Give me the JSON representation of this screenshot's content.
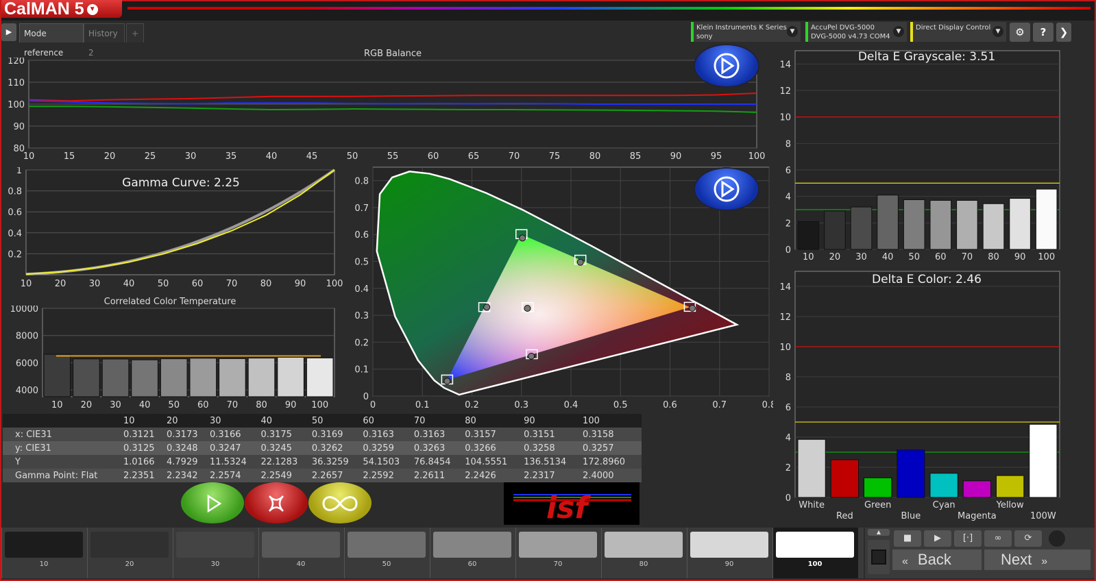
{
  "app": {
    "logo": "CalMAN 5"
  },
  "tabs": [
    {
      "label": "Mode reference"
    },
    {
      "label": "History 2"
    },
    {
      "label": "+"
    }
  ],
  "devices": [
    {
      "line1": "Klein Instruments K Series",
      "line2": "sony",
      "color": "#2cd42c"
    },
    {
      "line1": "AccuPel DVG-5000",
      "line2": "DVG-5000 v4.73 COM4",
      "color": "#2cd42c"
    },
    {
      "line1": "Direct Display Control",
      "line2": "",
      "color": "#e8e01a"
    }
  ],
  "toolbar": {
    "settings_icon": "gear-icon",
    "help_label": "?",
    "collapse_icon": "chevron-right-icon"
  },
  "rgb_balance": {
    "title": "RGB Balance",
    "chart_data": {
      "type": "line",
      "x": [
        10,
        15,
        20,
        25,
        30,
        35,
        40,
        45,
        50,
        55,
        60,
        65,
        70,
        75,
        80,
        85,
        90,
        95,
        100
      ],
      "series": [
        {
          "values": [
            102,
            101.5,
            102,
            102.3,
            102.5,
            103,
            103.5,
            103.5,
            103.5,
            103.7,
            103.8,
            104,
            104,
            104,
            104,
            104,
            104,
            104.2,
            105
          ],
          "color": "#e01010"
        },
        {
          "values": [
            101.5,
            101,
            100.5,
            100.3,
            100.2,
            100.5,
            100.5,
            100.5,
            100.3,
            100.2,
            100.3,
            100.2,
            100.3,
            100.2,
            100,
            100,
            100,
            100,
            100
          ],
          "color": "#2030ff"
        },
        {
          "values": [
            99,
            99,
            98.8,
            98.5,
            98.2,
            97.8,
            97.5,
            97.6,
            97.8,
            97.7,
            97.6,
            97.5,
            97.5,
            97.4,
            97.3,
            97.2,
            97,
            96.8,
            96.3
          ],
          "color": "#10a010"
        }
      ],
      "xlim": [
        10,
        100
      ],
      "ylim": [
        80,
        120
      ],
      "xticks": [
        "10",
        "15",
        "20",
        "25",
        "30",
        "35",
        "40",
        "45",
        "50",
        "55",
        "60",
        "65",
        "70",
        "75",
        "80",
        "85",
        "90",
        "95",
        "100"
      ],
      "yticks": [
        "120",
        "110",
        "100",
        "90",
        "80"
      ]
    }
  },
  "gamma": {
    "title": "Gamma Curve: 2.25",
    "chart_data": {
      "type": "line",
      "x": [
        10,
        20,
        30,
        40,
        50,
        60,
        70,
        80,
        90,
        100
      ],
      "target_gamma": 2.25,
      "measured": [
        0.006,
        0.027,
        0.065,
        0.121,
        0.198,
        0.298,
        0.42,
        0.568,
        0.762,
        1.0
      ],
      "xlim": [
        10,
        100
      ],
      "ylim": [
        0,
        1
      ],
      "xticks": [
        "10",
        "20",
        "30",
        "40",
        "50",
        "60",
        "70",
        "80",
        "90",
        "100"
      ],
      "yticks": [
        "1",
        "0.8",
        "0.6",
        "0.4",
        "0.2"
      ]
    }
  },
  "cct": {
    "title": "Correlated Color Temperature",
    "chart_data": {
      "type": "bar",
      "categories": [
        "10",
        "20",
        "30",
        "40",
        "50",
        "60",
        "70",
        "80",
        "90",
        "100"
      ],
      "values": [
        6620,
        6280,
        6270,
        6210,
        6290,
        6330,
        6300,
        6340,
        6400,
        6350
      ],
      "target": 6500,
      "ylim": [
        3500,
        10000
      ],
      "yticks": [
        "10000",
        "8000",
        "6000",
        "4000"
      ]
    }
  },
  "cie": {
    "chart_data": {
      "type": "scatter",
      "gamut_targets": [
        {
          "x": 0.64,
          "y": 0.33
        },
        {
          "x": 0.3,
          "y": 0.6
        },
        {
          "x": 0.15,
          "y": 0.06
        },
        {
          "x": 0.225,
          "y": 0.329
        },
        {
          "x": 0.321,
          "y": 0.154
        },
        {
          "x": 0.419,
          "y": 0.505
        },
        {
          "x": 0.3127,
          "y": 0.329
        }
      ],
      "measured": [
        {
          "x": 0.645,
          "y": 0.326
        },
        {
          "x": 0.302,
          "y": 0.587
        },
        {
          "x": 0.15,
          "y": 0.055
        },
        {
          "x": 0.23,
          "y": 0.33
        },
        {
          "x": 0.32,
          "y": 0.148
        },
        {
          "x": 0.419,
          "y": 0.497
        },
        {
          "x": 0.3121,
          "y": 0.3257
        }
      ],
      "xlim": [
        0,
        0.8
      ],
      "ylim": [
        0,
        0.85
      ],
      "xticks": [
        "0",
        "0.1",
        "0.2",
        "0.3",
        "0.4",
        "0.5",
        "0.6",
        "0.7",
        "0.8"
      ],
      "yticks": [
        "0.8",
        "0.7",
        "0.6",
        "0.5",
        "0.4",
        "0.3",
        "0.2",
        "0.1",
        "0"
      ]
    }
  },
  "de_gray": {
    "title": "Delta E Grayscale: 3.51",
    "chart_data": {
      "type": "bar",
      "categories": [
        "10",
        "20",
        "30",
        "40",
        "50",
        "60",
        "70",
        "80",
        "90",
        "100"
      ],
      "values": [
        2.1,
        2.9,
        3.2,
        4.1,
        3.75,
        3.7,
        3.7,
        3.45,
        3.85,
        4.55
      ],
      "ylim": [
        0,
        15
      ],
      "yticks": [
        "14",
        "12",
        "10",
        "8",
        "6",
        "4",
        "2",
        "0"
      ],
      "lines": [
        {
          "value": 10,
          "color": "#d01010"
        },
        {
          "value": 5,
          "color": "#d8d010"
        },
        {
          "value": 3,
          "color": "#10a010"
        }
      ]
    }
  },
  "de_color": {
    "title": "Delta E Color: 2.46",
    "chart_data": {
      "type": "bar",
      "categories": [
        "White",
        "Red",
        "Green",
        "Blue",
        "Cyan",
        "Magenta",
        "Yellow",
        "100W"
      ],
      "values": [
        3.85,
        2.5,
        1.3,
        3.15,
        1.6,
        1.1,
        1.45,
        4.85
      ],
      "colors": [
        "#cfcfcf",
        "#c00000",
        "#00c000",
        "#0000c0",
        "#00c0c0",
        "#c000c0",
        "#c0c000",
        "#ffffff"
      ],
      "ylim": [
        0,
        15
      ],
      "yticks": [
        "14",
        "12",
        "10",
        "8",
        "6",
        "4",
        "2",
        "0"
      ],
      "lines": [
        {
          "value": 10,
          "color": "#d01010"
        },
        {
          "value": 5,
          "color": "#d8d010"
        },
        {
          "value": 3,
          "color": "#10a010"
        }
      ]
    }
  },
  "table": {
    "header": [
      "",
      "10",
      "20",
      "30",
      "40",
      "50",
      "60",
      "70",
      "80",
      "90",
      "100"
    ],
    "rows": [
      [
        "x: CIE31",
        "0.3121",
        "0.3173",
        "0.3166",
        "0.3175",
        "0.3169",
        "0.3163",
        "0.3163",
        "0.3157",
        "0.3151",
        "0.3158"
      ],
      [
        "y: CIE31",
        "0.3125",
        "0.3248",
        "0.3247",
        "0.3245",
        "0.3262",
        "0.3259",
        "0.3263",
        "0.3266",
        "0.3258",
        "0.3257"
      ],
      [
        "Y",
        "1.0166",
        "4.7929",
        "11.5324",
        "22.1283",
        "36.3259",
        "54.1503",
        "76.8454",
        "104.5551",
        "136.5134",
        "172.8960"
      ],
      [
        "Gamma Point: Flat",
        "2.2351",
        "2.2342",
        "2.2574",
        "2.2549",
        "2.2657",
        "2.2592",
        "2.2611",
        "2.2426",
        "2.2317",
        "2.4000"
      ]
    ]
  },
  "buttons": {
    "play_icon": "play-icon",
    "stop_icon": "stop-x-icon",
    "loop_icon": "infinity-icon"
  },
  "isf_logo": "isf",
  "swatches": [
    {
      "label": "10",
      "color": "#1c1c1c"
    },
    {
      "label": "20",
      "color": "#303030"
    },
    {
      "label": "30",
      "color": "#444"
    },
    {
      "label": "40",
      "color": "#585858"
    },
    {
      "label": "50",
      "color": "#6e6e6e"
    },
    {
      "label": "60",
      "color": "#858585"
    },
    {
      "label": "70",
      "color": "#9e9e9e"
    },
    {
      "label": "80",
      "color": "#b9b9b9"
    },
    {
      "label": "90",
      "color": "#d8d8d8"
    },
    {
      "label": "100",
      "color": "#ffffff"
    }
  ],
  "nav": {
    "back_label": "Back",
    "next_label": "Next"
  }
}
